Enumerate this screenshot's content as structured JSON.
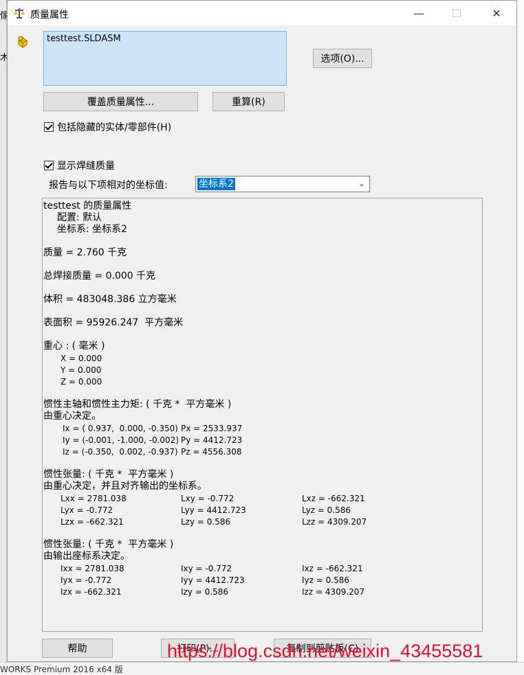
{
  "background": {
    "left_fragments": [
      "傢",
      "木"
    ],
    "bottom_text": "WORKS Premium 2016 x64 版"
  },
  "dialog": {
    "title": "质量属性",
    "controls": {
      "minimize": "—",
      "maximize": "☐",
      "close": "✕"
    },
    "selection_item": "testtest.SLDASM",
    "options_button": "选项(O)...",
    "override_button": "覆盖质量属性...",
    "recalc_button": "重算(R)",
    "include_hidden_label": "包括隐藏的实体/零部件(H)",
    "include_hidden_checked": true,
    "show_weld_label": "显示焊缝质量",
    "show_weld_checked": true,
    "report_label": "报告与以下项相对的坐标值:",
    "coord_value": "坐标系2",
    "help_button": "帮助",
    "print_button": "打印(P)...",
    "copy_button": "复制到剪贴板(C)"
  },
  "report": {
    "header": "testtest 的质量属性",
    "config_line": "配置: 默认",
    "coord_line": "坐标系: 坐标系2",
    "mass": "质量 = 2.760 千克",
    "weld_mass": "总焊接质量 = 0.000 千克",
    "volume": "体积 = 483048.386 立方毫米",
    "surface": "表面积 = 95926.247  平方毫米",
    "cog_title": "重心 : ( 毫米 )",
    "cog": [
      "X = 0.000",
      "Y = 0.000",
      "Z = 0.000"
    ],
    "principal_title": "惯性主轴和惯性主力矩: ( 千克 *  平方毫米 )",
    "principal_sub": "由重心决定。",
    "principal_rows": [
      {
        "axis": "Ix = ( 0.937,  0.000, -0.350)",
        "p": "Px = 2533.937"
      },
      {
        "axis": "Iy = (-0.001, -1.000, -0.002)",
        "p": "Py = 4412.723"
      },
      {
        "axis": "Iz = (-0.350,  0.002, -0.937)",
        "p": "Pz = 4556.308"
      }
    ],
    "tensor1_title": "惯性张量: ( 千克 *  平方毫米 )",
    "tensor1_sub": "由重心决定，并且对齐输出的坐标系。",
    "tensor1_rows": [
      [
        "Lxx = 2781.038",
        "Lxy = -0.772",
        "Lxz = -662.321"
      ],
      [
        "Lyx = -0.772",
        "Lyy = 4412.723",
        "Lyz = 0.586"
      ],
      [
        "Lzx = -662.321",
        "Lzy = 0.586",
        "Lzz = 4309.207"
      ]
    ],
    "tensor2_title": "惯性张量: ( 千克 *  平方毫米 )",
    "tensor2_sub": "由输出座标系决定。",
    "tensor2_rows": [
      [
        "Ixx = 2781.038",
        "Ixy = -0.772",
        "Ixz = -662.321"
      ],
      [
        "Iyx = -0.772",
        "Iyy = 4412.723",
        "Iyz = 0.586"
      ],
      [
        "Izx = -662.321",
        "Izy = 0.586",
        "Izz = 4309.207"
      ]
    ]
  },
  "watermark": "https://blog.csdn.net/weixin_43455581"
}
